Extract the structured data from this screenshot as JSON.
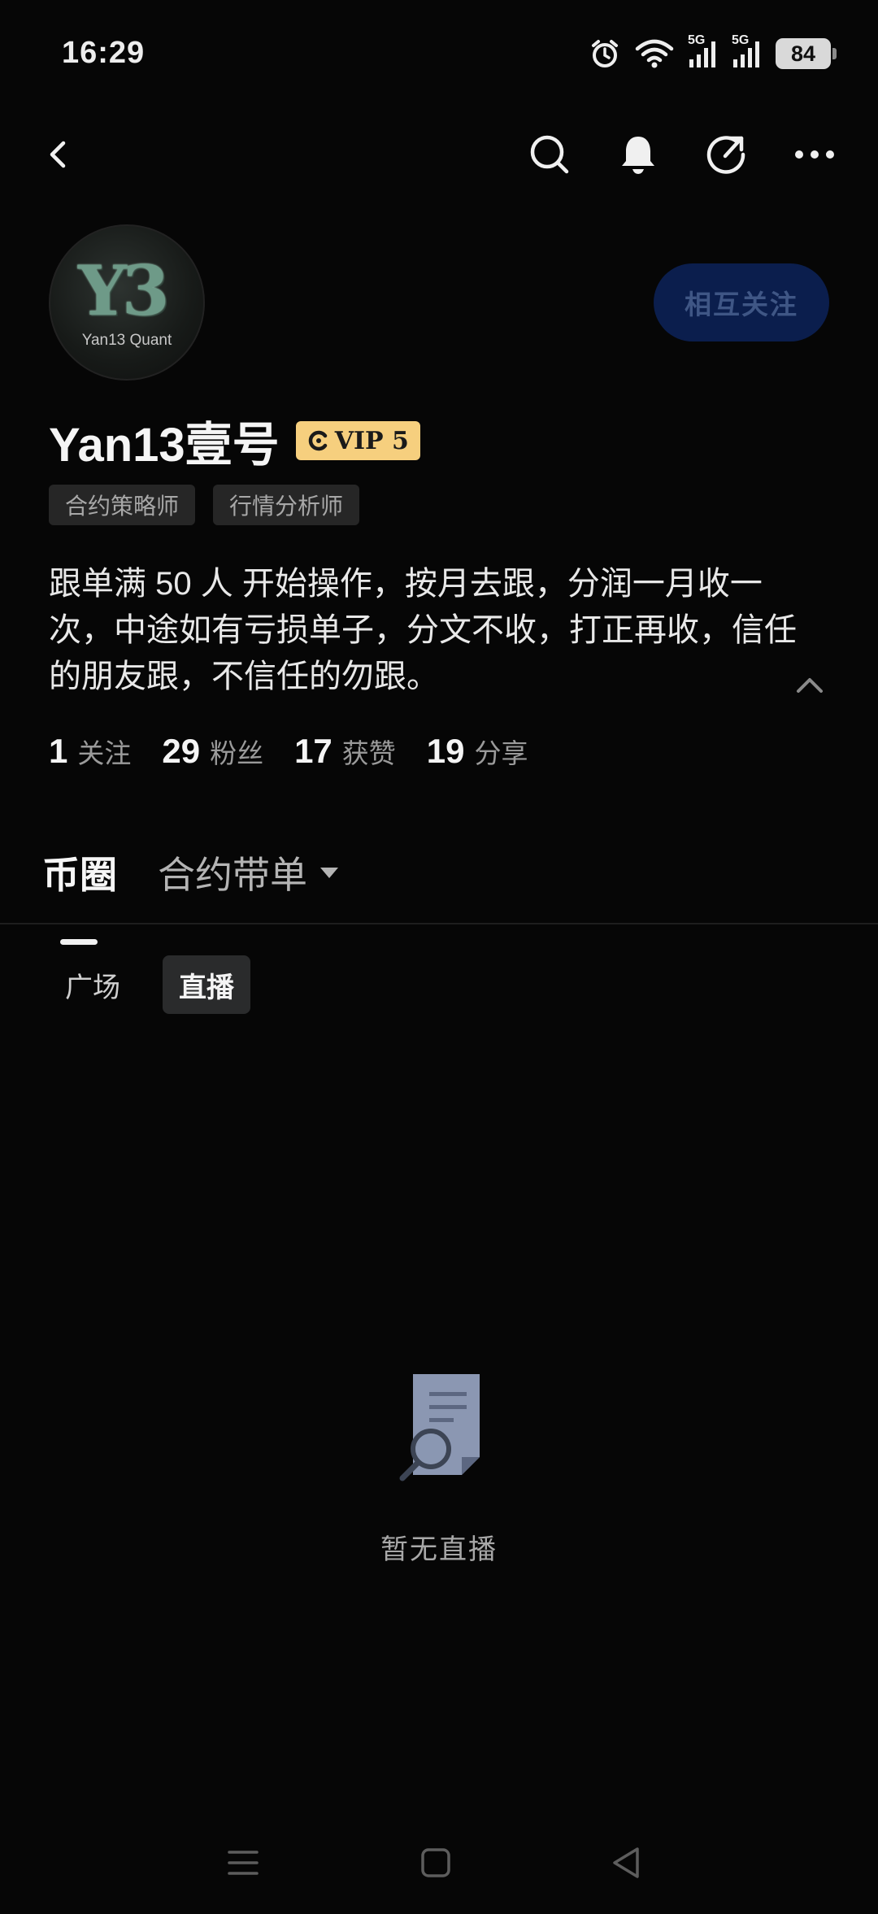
{
  "status_bar": {
    "time": "16:29",
    "network1": "5G",
    "network2": "5G",
    "battery": "84"
  },
  "topbar": {
    "icons": [
      "back-icon",
      "search-icon",
      "bell-icon",
      "share-icon",
      "more-icon"
    ]
  },
  "profile": {
    "avatar_text": "Y3",
    "avatar_brand": "Yan13 Quant",
    "name": "Yan13壹号",
    "vip_label": "VIP 5",
    "follow_button": "相互关注",
    "tags": [
      "合约策略师",
      "行情分析师"
    ],
    "bio": "跟单满 50 人 开始操作，按月去跟，分润一月收一次，中途如有亏损单子，分文不收，打正再收，信任的朋友跟，不信任的勿跟。"
  },
  "stats": [
    {
      "value": "1",
      "label": "关注"
    },
    {
      "value": "29",
      "label": "粉丝"
    },
    {
      "value": "17",
      "label": "获赞"
    },
    {
      "value": "19",
      "label": "分享"
    }
  ],
  "tabs": {
    "active": "币圈",
    "second": "合约带单"
  },
  "subtabs": [
    "广场",
    "直播"
  ],
  "empty_state": {
    "text": "暂无直播"
  },
  "colors": {
    "background": "#060606",
    "vip": "#f6cf7e",
    "follow_button_bg": "#0b1e4d"
  }
}
